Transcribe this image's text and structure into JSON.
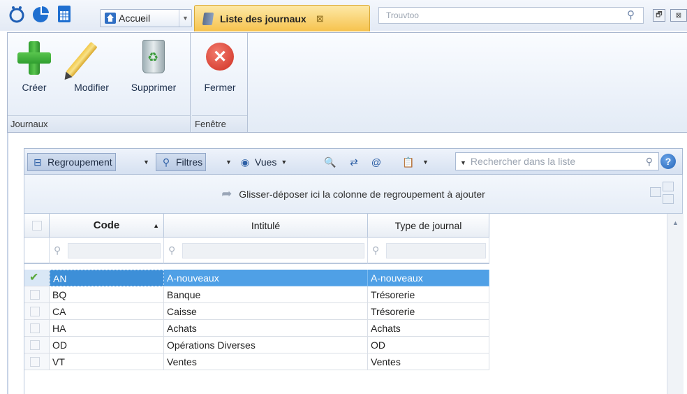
{
  "topbar": {
    "home_label": "Accueil",
    "tab_title": "Liste des journaux",
    "search_placeholder": "Trouvtoo"
  },
  "ribbon": {
    "groups": [
      {
        "caption": "Journaux",
        "buttons": [
          "Créer",
          "Modifier",
          "Supprimer"
        ]
      },
      {
        "caption": "Fenêtre",
        "buttons": [
          "Fermer"
        ]
      }
    ]
  },
  "toolbar": {
    "grouping": "Regroupement",
    "filters": "Filtres",
    "views": "Vues",
    "search_placeholder": "Rechercher dans la liste",
    "help": "?"
  },
  "groupbar": {
    "hint": "Glisser-déposer ici la colonne de regroupement à ajouter"
  },
  "grid": {
    "columns": [
      "Code",
      "Intitulé",
      "Type de journal"
    ],
    "sorted_column": "Code",
    "rows": [
      {
        "code": "AN",
        "label": "A-nouveaux",
        "type": "A-nouveaux",
        "selected": true
      },
      {
        "code": "BQ",
        "label": "Banque",
        "type": "Trésorerie",
        "selected": false
      },
      {
        "code": "CA",
        "label": "Caisse",
        "type": "Trésorerie",
        "selected": false
      },
      {
        "code": "HA",
        "label": "Achats",
        "type": "Achats",
        "selected": false
      },
      {
        "code": "OD",
        "label": "Opérations Diverses",
        "type": "OD",
        "selected": false
      },
      {
        "code": "VT",
        "label": "Ventes",
        "type": "Ventes",
        "selected": false
      }
    ]
  },
  "colors": {
    "selection": "#4fa0e6",
    "active_tab": "#f6c24d",
    "ribbon_bg": "#e3ebf6"
  }
}
